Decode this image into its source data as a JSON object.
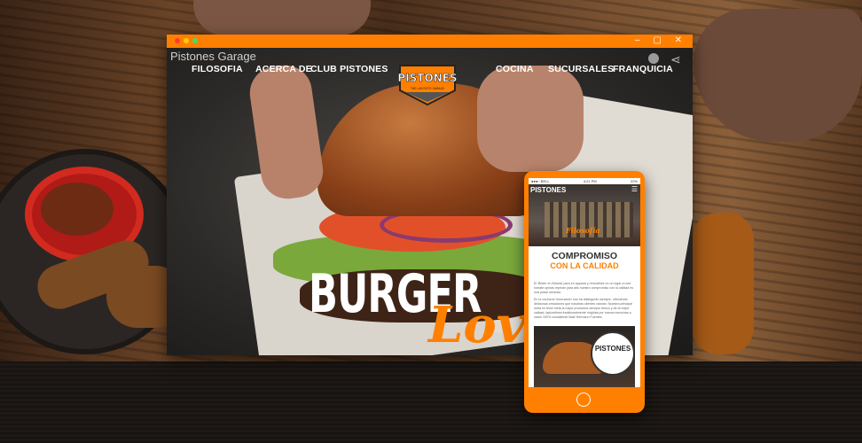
{
  "browser": {
    "site_title": "Pistones Garage",
    "nav_left": [
      "FILOSOFIA",
      "ACERCA DE",
      "CLUB PISTONES"
    ],
    "nav_right": [
      "COCINA",
      "SUCURSALES",
      "FRANQUICIA"
    ],
    "logo": {
      "name": "PISTONES",
      "tagline": "THE LAS ROTO GARAGE"
    },
    "hero": {
      "line1": "BURGER",
      "line2": "Love"
    },
    "icons": [
      "clock-icon",
      "share-icon"
    ],
    "window_controls": "– ▢ ✕"
  },
  "phone": {
    "status_left": "●●●○ BELL",
    "status_time": "4:21 PM",
    "status_right": "22%",
    "logo": "PISTONES",
    "menu_icon": "☰",
    "section_label": "Filosofía",
    "heading1": "COMPROMISO",
    "heading2": "CON LA CALIDAD",
    "body": [
      "El 'Brider en Brianta' para en apparal y remonthes on un logar a roce romate opinas repman yara alto nuestro compromiso con la calidad es una prase medular.",
      "En la cocina la 'Innovación' nos ha distinguido siempre, ofreciendo deliciosas creaciones que nosotras clientes valoran. Nuestra principal meta en tenel meta la mejor productos siempre fresco y de la mejor calidad, lapizarlinea tradicionalmente irrigidas por manos escuchas a carne 100% consistente Bate Hermano Fuentes."
    ],
    "badge": "PISTONES",
    "badge_small": "CALIDAD PREMIUM"
  },
  "colors": {
    "accent": "#ff8000",
    "chrome": "#ff8000",
    "dark": "#222222"
  }
}
